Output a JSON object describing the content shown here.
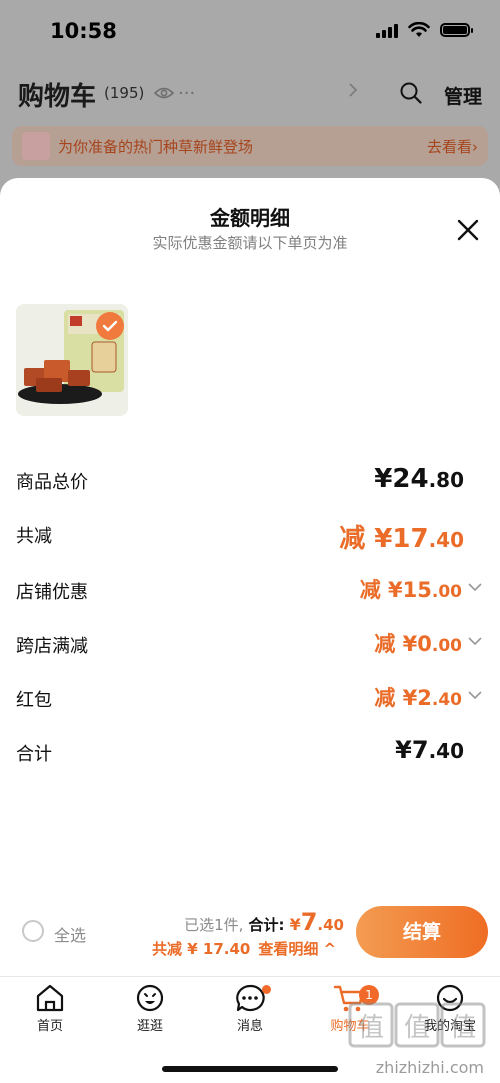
{
  "status_bar": {
    "time": "10:58"
  },
  "cart": {
    "title": "购物车",
    "count": "(195)",
    "dots": "...",
    "manage": "管理",
    "banner_text": "为你准备的热门种草新鲜登场",
    "banner_link": "去看看",
    "banner_link_arrow": "›"
  },
  "sheet": {
    "title": "金额明细",
    "subtitle": "实际优惠金额请以下单页为准",
    "rows": [
      {
        "label": "商品总价",
        "prefix": "",
        "big": "¥24",
        "dec": ".80"
      },
      {
        "label": "共减",
        "prefix": "减 ",
        "big": "¥17",
        "dec": ".40"
      },
      {
        "label": "店铺优惠",
        "prefix": "减 ",
        "big": "¥15",
        "dec": ".00"
      },
      {
        "label": "跨店满减",
        "prefix": "减 ",
        "big": "¥0",
        "dec": ".00"
      },
      {
        "label": "红包",
        "prefix": "减 ",
        "big": "¥2",
        "dec": ".40"
      },
      {
        "label": "合计",
        "prefix": "",
        "big": "¥7",
        "dec": ".40"
      }
    ]
  },
  "checkout": {
    "select_all": "全选",
    "selected": "已选1件,",
    "total_label": "合计:",
    "total_yen": "¥",
    "total_big": "7",
    "total_dec": ".40",
    "reduce": "共减 ¥ 17.40",
    "detail": "查看明细 ^",
    "button": "结算"
  },
  "tabbar": {
    "tabs": [
      {
        "label": "首页"
      },
      {
        "label": "逛逛"
      },
      {
        "label": "消息"
      },
      {
        "label": "购物车"
      },
      {
        "label": "我的淘宝"
      }
    ],
    "cart_badge": "1"
  },
  "watermark": {
    "text": "zhizhizhi.com",
    "logo": "值"
  },
  "colors": {
    "accent": "#ea6c28",
    "button_start": "#f39c52",
    "button_end": "#ef6d24",
    "overlay": "#a9a9a9"
  }
}
